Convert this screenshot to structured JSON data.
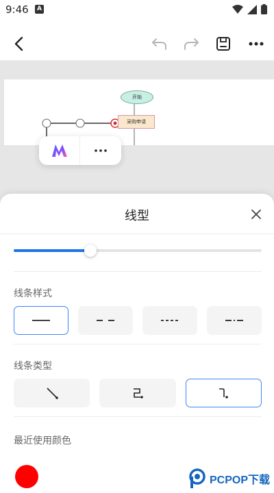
{
  "status": {
    "time": "9:46",
    "notification_glyph": "A"
  },
  "toolbar": {
    "back": "back-arrow-icon",
    "undo": "undo-icon",
    "redo": "redo-icon",
    "save": "save-icon",
    "more": "more-horizontal-icon"
  },
  "diagram": {
    "start_node": "开始",
    "process_node": "采购申请"
  },
  "sheet": {
    "title": "线型",
    "width_slider_percent": 31,
    "line_style_label": "线条样式",
    "line_styles": [
      "solid",
      "dashed",
      "dotted",
      "dash-dot"
    ],
    "line_style_selected": 0,
    "line_type_label": "线条类型",
    "line_types": [
      "straight",
      "orthogonal-elbow",
      "orthogonal-rounded"
    ],
    "line_type_selected": 2,
    "recent_colors_label": "最近使用颜色",
    "recent_colors": [
      "#ff0000"
    ]
  },
  "colors": {
    "accent": "#1a73e8",
    "selected_border": "#3b82f6"
  },
  "watermark": {
    "text": "PCPOP下载"
  }
}
